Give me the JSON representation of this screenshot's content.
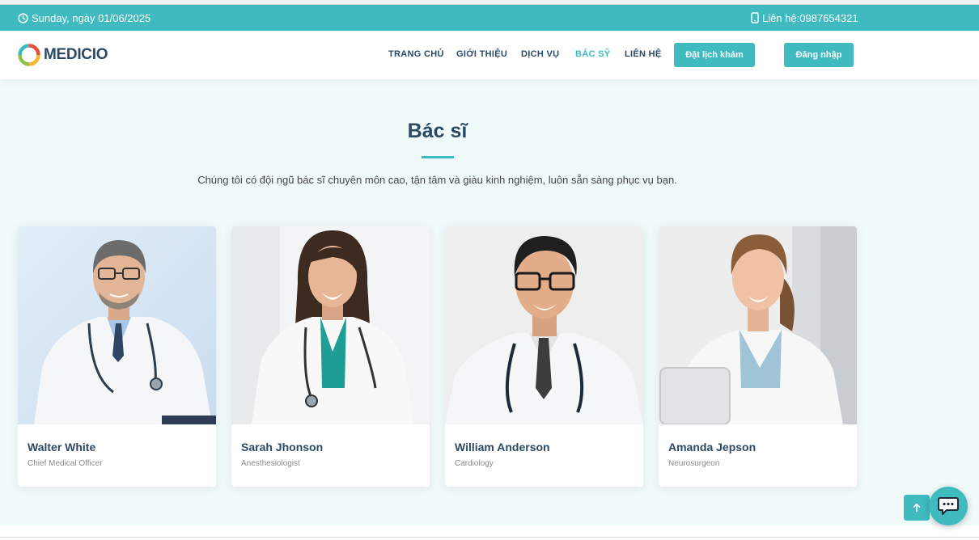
{
  "topbar": {
    "date": "Sunday, ngày 01/06/2025",
    "contact": "Liên hệ:0987654321",
    "bg_color": "#3fbbc0",
    "icons": [
      "clock-icon",
      "phone-icon"
    ]
  },
  "header": {
    "logo_text": "MEDICIO",
    "nav": [
      {
        "label": "TRANG CHỦ",
        "active": false
      },
      {
        "label": "GIỚI THIỆU",
        "active": false
      },
      {
        "label": "DỊCH VỤ",
        "active": false
      },
      {
        "label": "BÁC SỸ",
        "active": true
      },
      {
        "label": "LIÊN HỆ",
        "active": false
      }
    ],
    "book_button": "Đặt lịch khám",
    "login_button": "Đăng nhập"
  },
  "section": {
    "title": "Bác sĩ",
    "description": "Chúng tôi có đội ngũ bác sĩ chuyên môn cao, tận tâm và giàu kinh nghiệm, luôn sẵn sàng phục vụ bạn.",
    "bg_color": "#f1fafa"
  },
  "doctors": [
    {
      "name": "Walter White",
      "role": "Chief Medical Officer"
    },
    {
      "name": "Sarah Jhonson",
      "role": "Anesthesiologist"
    },
    {
      "name": "William Anderson",
      "role": "Cardiology"
    },
    {
      "name": "Amanda Jepson",
      "role": "Neurosurgeon"
    }
  ],
  "floating": {
    "back_to_top_icon": "arrow-up-icon",
    "chat_icon": "chat-bubble-icon"
  },
  "colors": {
    "accent": "#3fbbc0",
    "heading": "#2c4964"
  }
}
